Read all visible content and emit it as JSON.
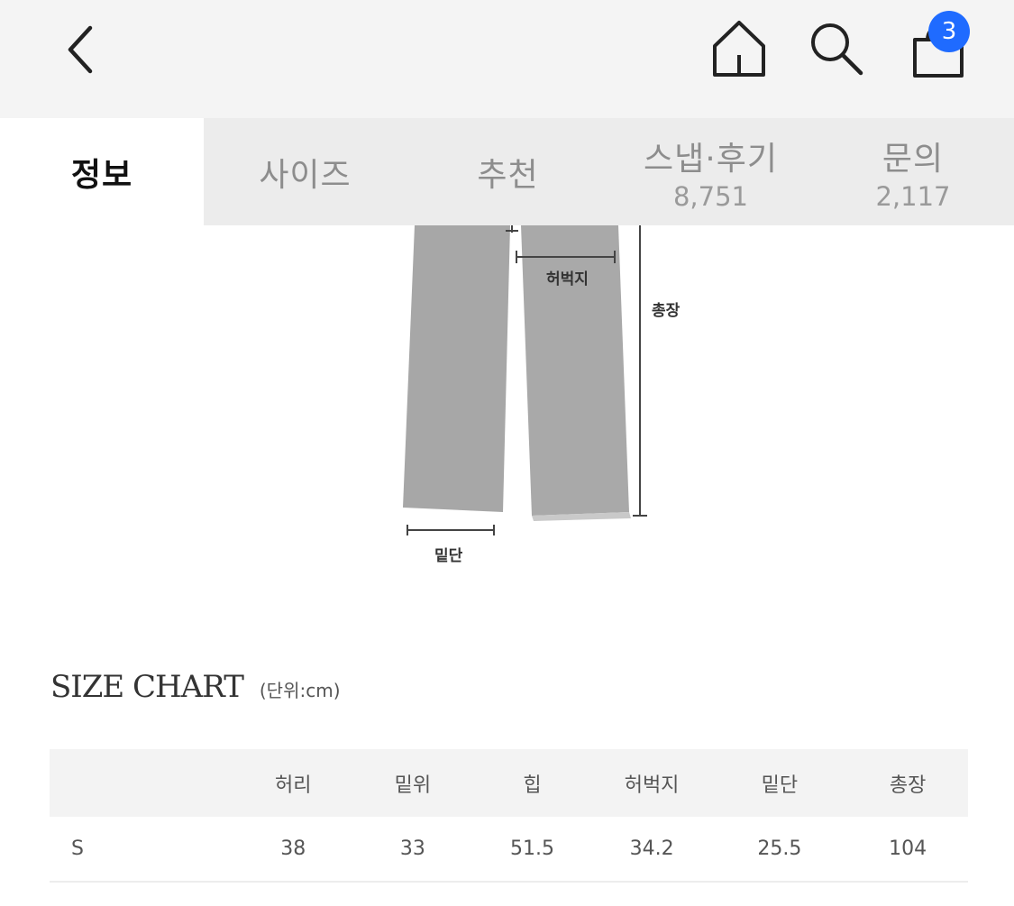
{
  "header": {
    "back_icon": "chevron-left-icon",
    "home_icon": "home-icon",
    "search_icon": "search-icon",
    "cart_icon": "shopping-bag-icon",
    "cart_badge": "3",
    "badge_color": "#1f6bff"
  },
  "tabs": [
    {
      "label": "정보",
      "count": "",
      "active": true
    },
    {
      "label": "사이즈",
      "count": ""
    },
    {
      "label": "추천",
      "count": ""
    },
    {
      "label": "스냅·후기",
      "count": "8,751"
    },
    {
      "label": "문의",
      "count": "2,117"
    }
  ],
  "diagram": {
    "thigh": "허벅지",
    "length": "총장",
    "hem": "밑단"
  },
  "size_chart": {
    "title": "SIZE CHART",
    "unit": "(단위:cm)",
    "headers": [
      "",
      "허리",
      "밑위",
      "힙",
      "허벅지",
      "밑단",
      "총장"
    ],
    "rows": [
      [
        "S",
        "38",
        "33",
        "51.5",
        "34.2",
        "25.5",
        "104"
      ]
    ]
  }
}
